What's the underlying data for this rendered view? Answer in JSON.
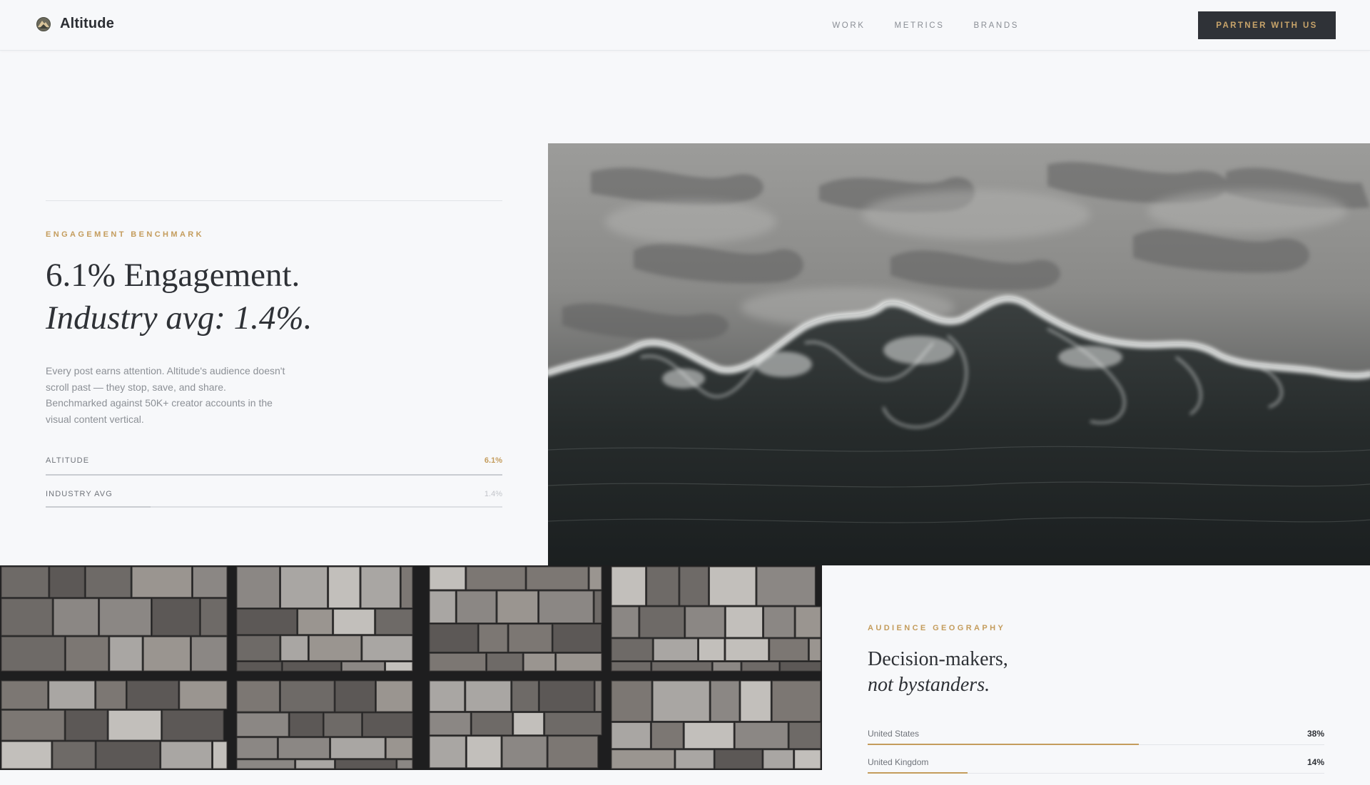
{
  "header": {
    "brand": "Altitude",
    "nav": [
      "WORK",
      "METRICS",
      "BRANDS"
    ],
    "cta": "PARTNER WITH US"
  },
  "engagement": {
    "eyebrow": "ENGAGEMENT BENCHMARK",
    "headline_line1": "6.1% Engagement.",
    "headline_line2": "Industry avg: 1.4%.",
    "body": "Every post earns attention. Altitude's audience doesn't scroll past — they stop, save, and share. Benchmarked against 50K+ creator accounts in the visual content vertical.",
    "metrics": [
      {
        "label": "ALTITUDE",
        "value": "6.1%",
        "fill": 1.0
      },
      {
        "label": "INDUSTRY AVG",
        "value": "1.4%",
        "fill": 0.23
      }
    ]
  },
  "geography": {
    "eyebrow": "AUDIENCE GEOGRAPHY",
    "headline_line1": "Decision-makers,",
    "headline_line2": "not bystanders.",
    "countries": [
      {
        "name": "United States",
        "pct": "38%",
        "share": 0.38
      },
      {
        "name": "United Kingdom",
        "pct": "14%",
        "share": 0.14
      }
    ]
  },
  "colors": {
    "accent": "#c49c5c",
    "dark": "#2f3237",
    "background": "#f7f8fa"
  },
  "icons": {
    "brand": "mountain-logo-icon"
  }
}
